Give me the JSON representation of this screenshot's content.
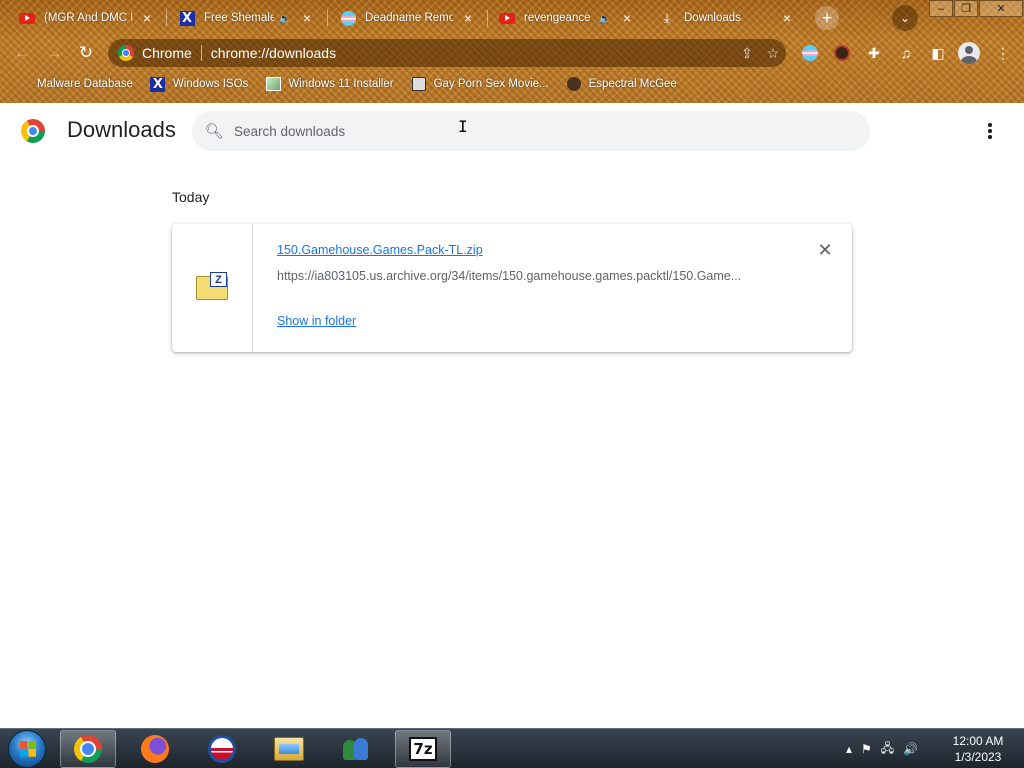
{
  "tabs": [
    {
      "title": "(MGR And DMC M",
      "icon": "youtube-icon",
      "audio": false
    },
    {
      "title": "Free Shemale",
      "icon": "x-icon",
      "audio": true
    },
    {
      "title": "Deadname Remove",
      "icon": "trans-flag-icon",
      "audio": false
    },
    {
      "title": "revengeance",
      "icon": "youtube-icon",
      "audio": true
    },
    {
      "title": "Downloads",
      "icon": "download-icon",
      "audio": false,
      "active": true
    }
  ],
  "window_controls": {
    "minimize": "–",
    "restore": "❐",
    "close": "✕"
  },
  "toolbar": {
    "origin": "Chrome",
    "url": "chrome://downloads"
  },
  "bookmarks": [
    {
      "label": "Malware Database",
      "icon": "blank-icon"
    },
    {
      "label": "Windows ISOs",
      "icon": "x-icon"
    },
    {
      "label": "Windows 11 Installer",
      "icon": "image-icon"
    },
    {
      "label": "Gay Porn Sex Movie...",
      "icon": "package-icon"
    },
    {
      "label": "Espectral McGee",
      "icon": "avatar-icon"
    }
  ],
  "page": {
    "title": "Downloads",
    "search_placeholder": "Search downloads"
  },
  "downloads": {
    "section_date": "Today",
    "items": [
      {
        "filename": "150.Gamehouse.Games.Pack-TL.zip",
        "url": "https://ia803105.us.archive.org/34/items/150.gamehouse.games.packtl/150.Game...",
        "action": "Show in folder",
        "icon": "7zip-archive-icon"
      }
    ]
  },
  "taskbar": {
    "apps": [
      "chrome",
      "firefox",
      "obama-campaign",
      "file-explorer",
      "windows-live-messenger",
      "7-zip"
    ],
    "clock_time": "12:00 AM",
    "clock_date": "1/3/2023"
  },
  "colors": {
    "link": "#1a73e8",
    "theme_brown": "#b7772a",
    "search_bg": "#f1f3f4"
  }
}
